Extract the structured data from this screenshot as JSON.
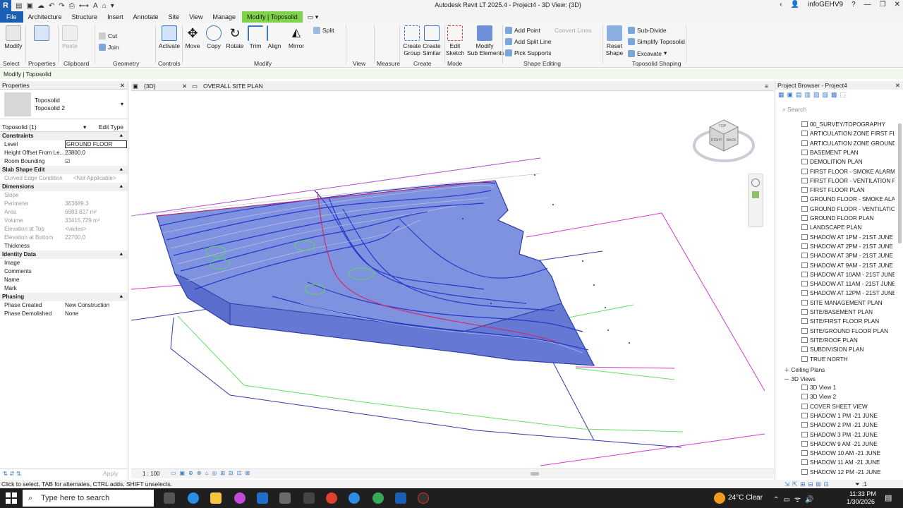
{
  "titlebar": {
    "app_icon": "R",
    "title": "Autodesk Revit LT 2025.4 - Project4 - 3D View: {3D}",
    "user": "infoGEHV9",
    "help": "?",
    "minimize": "—",
    "restore": "❐",
    "close": "✕"
  },
  "menubar": {
    "tabs": [
      "File",
      "Architecture",
      "Structure",
      "Insert",
      "Annotate",
      "Site",
      "View",
      "Manage"
    ],
    "contextual_tab": "Modify | Toposolid"
  },
  "ribbon": {
    "modify": "Modify",
    "properties": "Properties",
    "paste": "Paste",
    "cut": "Cut",
    "join": "Join",
    "activate": "Activate",
    "move": "Move",
    "copy": "Copy",
    "rotate": "Rotate",
    "trim": "Trim",
    "align": "Align",
    "mirror": "Mirror",
    "split": "Split",
    "create_group": "Create\nGroup",
    "create_similar": "Create\nSimilar",
    "edit_sketch": "Edit\nSketch",
    "modify_sub": "Modify\nSub Elements",
    "add_point": "Add Point",
    "convert_lines": "Convert Lines",
    "add_split_line": "Add Split Line",
    "pick_supports": "Pick Supports",
    "reset_shape": "Reset\nShape",
    "sub_divide": "Sub-Divide",
    "simplify": "Simplify Toposolid",
    "excavate": "Excavate",
    "panels": {
      "select": "Select",
      "properties": "Properties",
      "clipboard": "Clipboard",
      "geometry": "Geometry",
      "controls": "Controls",
      "modify": "Modify",
      "view": "View",
      "measure": "Measure",
      "create": "Create",
      "mode": "Mode",
      "shape_editing": "Shape Editing",
      "toposolid_shaping": "Toposolid Shaping"
    }
  },
  "optionsbar": {
    "text": "Modify | Toposolid"
  },
  "properties": {
    "title": "Properties",
    "type_line1": "Toposolid",
    "type_line2": "Toposolid 2",
    "filter": "Toposolid (1)",
    "edit_type": "Edit Type",
    "groups": {
      "constraints": "Constraints",
      "slab_shape": "Slab Shape Edit",
      "dimensions": "Dimensions",
      "identity": "Identity Data",
      "phasing": "Phasing"
    },
    "level_label": "Level",
    "level_value": "GROUND FLOOR",
    "height_label": "Height Offset From Le...",
    "height_value": "23800.0",
    "room_bounding": "Room Bounding",
    "curved_label": "Curved Edge Condition",
    "curved_value": "<Not Applicable>",
    "slope": "Slope",
    "perimeter_label": "Perimeter",
    "perimeter_value": "363689.3",
    "area_label": "Area",
    "area_value": "6983.827 m²",
    "volume_label": "Volume",
    "volume_value": "33415.729 m³",
    "elev_top_label": "Elevation at Top",
    "elev_top_value": "<varies>",
    "elev_bottom_label": "Elevation at Bottom",
    "elev_bottom_value": "22700.0",
    "thickness": "Thickness",
    "image": "Image",
    "comments": "Comments",
    "name": "Name",
    "mark": "Mark",
    "phase_created_label": "Phase Created",
    "phase_created_value": "New Construction",
    "phase_demolished_label": "Phase Demolished",
    "phase_demolished_value": "None",
    "apply": "Apply"
  },
  "viewtabs": {
    "tab1": "{3D}",
    "tab2": "OVERALL SITE PLAN"
  },
  "viewbar": {
    "scale": "1 : 100"
  },
  "browser": {
    "title": "Project Browser - Project4",
    "search_placeholder": "Search",
    "floor_plans": [
      "00_SURVEY/TOPOGRAPHY",
      "ARTICULATION ZONE FIRST FLOOR",
      "ARTICULATION ZONE GROUND FLOOR",
      "BASEMENT PLAN",
      "DEMOLITION PLAN",
      "FIRST FLOOR - SMOKE ALARM LAYOUT",
      "FIRST FLOOR - VENTILATION PLAN",
      "FIRST FLOOR PLAN",
      "GROUND FLOOR - SMOKE ALARM",
      "GROUND FLOOR - VENTILATION PLAN",
      "GROUND FLOOR PLAN",
      "LANDSCAPE PLAN",
      "SHADOW AT 1PM - 21ST JUNE",
      "SHADOW AT 2PM - 21ST JUNE",
      "SHADOW AT 3PM - 21ST JUNE",
      "SHADOW AT 9AM - 21ST JUNE",
      "SHADOW AT 10AM - 21ST JUNE",
      "SHADOW AT 11AM - 21ST JUNE",
      "SHADOW AT 12PM - 21ST JUNE",
      "SITE MANAGEMENT PLAN",
      "SITE/BASEMENT PLAN",
      "SITE/FIRST FLOOR PLAN",
      "SITE/GROUND FLOOR PLAN",
      "SITE/ROOF PLAN",
      "SUBDIVISION PLAN",
      "TRUE NORTH"
    ],
    "ceiling_plans": "Ceiling Plans",
    "views_3d": "3D Views",
    "views_3d_items": [
      "3D View 1",
      "3D View 2",
      "COVER SHEET VIEW",
      "SHADOW 1 PM -21 JUNE",
      "SHADOW 2 PM -21 JUNE",
      "SHADOW 3 PM -21 JUNE",
      "SHADOW 9 AM -21 JUNE",
      "SHADOW 10 AM -21 JUNE",
      "SHADOW 11 AM -21 JUNE",
      "SHADOW 12 PM -21 JUNE"
    ]
  },
  "viewcube": {
    "top": "TOP",
    "right": "RIGHT",
    "back": "BACK"
  },
  "status": {
    "text": "Click to select, TAB for alternates, CTRL adds, SHIFT unselects.",
    "filter_count": ":1"
  },
  "taskbar": {
    "search_placeholder": "Type here to search",
    "weather": "24°C  Clear",
    "time": "11:33 PM",
    "date": "1/30/2026"
  }
}
